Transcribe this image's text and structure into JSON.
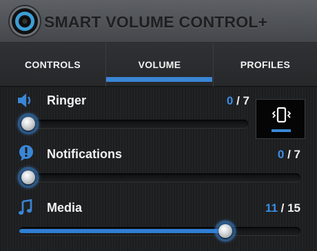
{
  "app": {
    "title": "SMART VOLUME CONTROL+"
  },
  "tabs": [
    {
      "label": "CONTROLS"
    },
    {
      "label": "VOLUME",
      "active": true
    },
    {
      "label": "PROFILES"
    }
  ],
  "rows": [
    {
      "label": "Ringer",
      "current": "0",
      "max": "/ 7",
      "level": 0.0,
      "icon": "speaker-icon"
    },
    {
      "label": "Notifications",
      "current": "0",
      "max": "/ 7",
      "level": 0.0,
      "icon": "exclamation-icon"
    },
    {
      "label": "Media",
      "current": "11",
      "max": "/ 15",
      "level": 0.733,
      "icon": "music-note-icon"
    }
  ],
  "vibrate": {
    "icon": "vibrate-icon"
  },
  "colors": {
    "accent": "#3a86d6",
    "value": "#3a8ee6",
    "header": "#505357",
    "background": "#1c1d1f"
  }
}
